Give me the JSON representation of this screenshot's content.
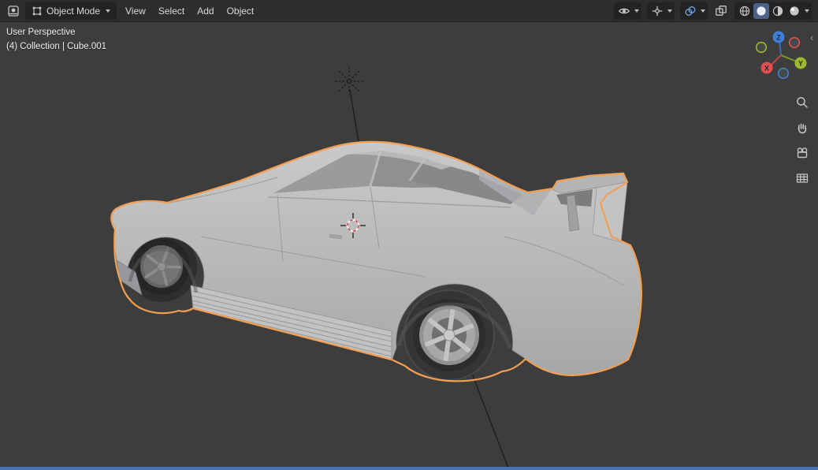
{
  "header": {
    "editor_type_icon": "viewport-editor-icon",
    "mode": {
      "label": "Object Mode",
      "icon": "object-mode-icon"
    },
    "menus": [
      {
        "label": "View"
      },
      {
        "label": "Select"
      },
      {
        "label": "Add"
      },
      {
        "label": "Object"
      }
    ],
    "right_icons": [
      {
        "name": "visibility-eye-icon"
      },
      {
        "name": "gizmo-icon"
      },
      {
        "name": "overlays-icon",
        "active": true
      },
      {
        "name": "xray-icon"
      },
      {
        "name": "shading-wireframe-icon"
      },
      {
        "name": "shading-solid-icon",
        "active": true
      },
      {
        "name": "shading-material-icon"
      },
      {
        "name": "shading-rendered-icon"
      }
    ]
  },
  "viewport": {
    "view_label": "User Perspective",
    "breadcrumb": "(4) Collection | Cube.001",
    "axes": {
      "x": "X",
      "y": "Y",
      "z": "Z"
    },
    "side_tools": [
      {
        "name": "zoom-icon"
      },
      {
        "name": "pan-hand-icon"
      },
      {
        "name": "camera-view-icon"
      },
      {
        "name": "toggle-ortho-grid-icon"
      }
    ]
  },
  "colors": {
    "selection_outline": "#f29f51",
    "axis_x": "#e34f4f",
    "axis_y": "#9cba2f",
    "axis_z": "#3f7fd9",
    "header_bg": "#2d2d2d",
    "viewport_bg": "#3d3d3d",
    "timeline_accent": "#4b72b0"
  }
}
